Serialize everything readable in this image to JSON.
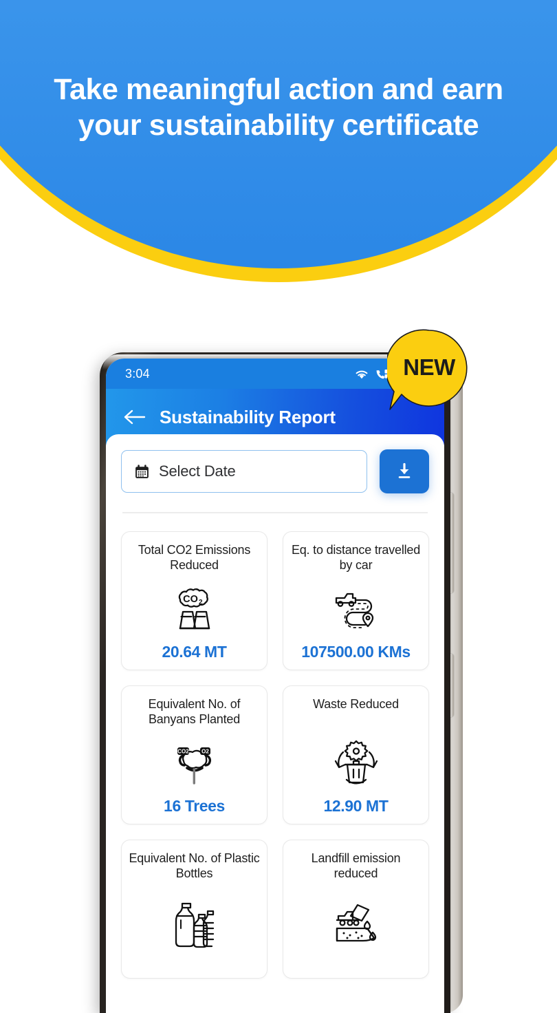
{
  "promo": {
    "headline": "Take meaningful action and earn your sustainability certificate",
    "banner_blue": "#3D97EC",
    "banner_yellow": "#FBCE10"
  },
  "badge": {
    "label": "NEW",
    "color": "#FBCE10"
  },
  "phone": {
    "statusbar": {
      "time": "3:04",
      "icons": [
        "wifi-icon",
        "volte-call-icon",
        "signal-bars-icon",
        "signal-bars-secondary-icon"
      ]
    },
    "appbar": {
      "back_icon": "back-arrow-icon",
      "title": "Sustainability Report",
      "accent_start": "#2297EA",
      "accent_end": "#0F35DF"
    },
    "toolbar": {
      "date_icon": "calendar-icon",
      "date_placeholder": "Select Date",
      "download_icon": "download-icon",
      "download_color": "#1C72D4"
    },
    "metrics": [
      {
        "title": "Total CO2 Emissions Reduced",
        "value": "20.64 MT",
        "icon": "co2-factory-icon"
      },
      {
        "title": "Eq. to distance travelled by car",
        "value": "107500.00 KMs",
        "icon": "car-route-icon"
      },
      {
        "title": "Equivalent No. of Banyans Planted",
        "value": "16 Trees",
        "icon": "tree-co2-icon"
      },
      {
        "title": "Waste Reduced",
        "value": "12.90 MT",
        "icon": "recycle-bin-icon"
      },
      {
        "title": "Equivalent No. of Plastic Bottles",
        "value": "",
        "icon": "plastic-bottles-icon"
      },
      {
        "title": "Landfill emission reduced",
        "value": "",
        "icon": "landfill-truck-icon"
      }
    ],
    "value_color": "#1C72D4"
  }
}
